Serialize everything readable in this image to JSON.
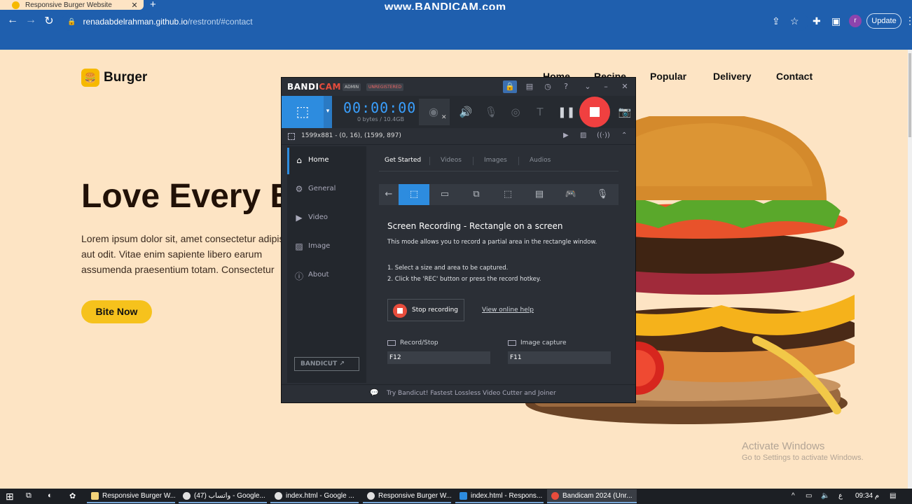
{
  "browser": {
    "tab_title": "Responsive Burger Website",
    "tab_close": "✕",
    "new_tab": "+",
    "url_host": "renadabdelrahman.github.io",
    "url_path": "/restront/#contact",
    "update_label": "Update",
    "profile_initial": "r"
  },
  "recorder_watermark": "www.BANDICAM.com",
  "site": {
    "logo_text": "Burger",
    "nav": [
      "Home",
      "Recipe",
      "Popular",
      "Delivery",
      "Contact"
    ],
    "hero_title": "Love Every Bite",
    "hero_text": [
      "Lorem ipsum dolor sit, amet consectetur adipisicing elit.",
      "aut odit. Vitae enim sapiente libero earum",
      "assumenda praesentium totam. Consectetur"
    ],
    "cta": "Bite Now"
  },
  "bandicam": {
    "brand_a": "BANDI",
    "brand_b": "CAM",
    "pill_admin": "ADMIN",
    "pill_unreg": "UNREGISTERED",
    "timer": "00:00:00",
    "size": "0 bytes / 10.4GB",
    "region": "1599x881 - (0, 16), (1599, 897)",
    "sidebar": [
      "Home",
      "General",
      "Video",
      "Image",
      "About"
    ],
    "bandicut": "BANDICUT ↗",
    "tabs": [
      "Get Started",
      "Videos",
      "Images",
      "Audios"
    ],
    "heading": "Screen Recording - Rectangle on a screen",
    "desc": "This mode allows you to record a partial area in the rectangle window.",
    "step1": "1. Select a size and area to be captured.",
    "step2": "2. Click the 'REC' button or press the record hotkey.",
    "stop_label": "Stop recording",
    "help_link": "View online help",
    "hk1_label": "Record/Stop",
    "hk1_value": "F12",
    "hk2_label": "Image capture",
    "hk2_value": "F11",
    "footer": "Try Bandicut! Fastest Lossless Video Cutter and Joiner"
  },
  "activation": {
    "title": "Activate Windows",
    "subtitle": "Go to Settings to activate Windows."
  },
  "taskbar": {
    "items": [
      "Responsive Burger W...",
      "(47) واتساب - Google...",
      "index.html - Google ...",
      "Responsive Burger W...",
      "index.html - Respons...",
      "Bandicam 2024 (Unr..."
    ],
    "lang": "ع",
    "time": "09:34 م"
  }
}
